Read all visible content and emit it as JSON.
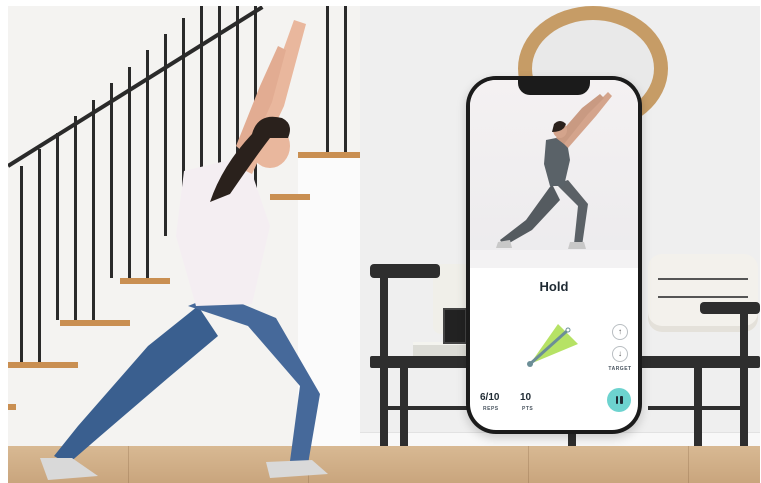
{
  "app": {
    "exercise_state": "Hold",
    "reps": "6/10",
    "reps_label": "REPS",
    "points": "10",
    "points_label": "PTS",
    "target_label": "TARGET",
    "target_progress": 0.6
  },
  "icons": {
    "target_up": "arrow-up-icon",
    "target_down": "arrow-down-icon",
    "pause": "pause-icon"
  },
  "colors": {
    "accent": "#6dd3cf",
    "gauge_fill": "#a9dd4a",
    "gauge_needle": "#6c8e97",
    "text_dark": "#1f2a33"
  }
}
